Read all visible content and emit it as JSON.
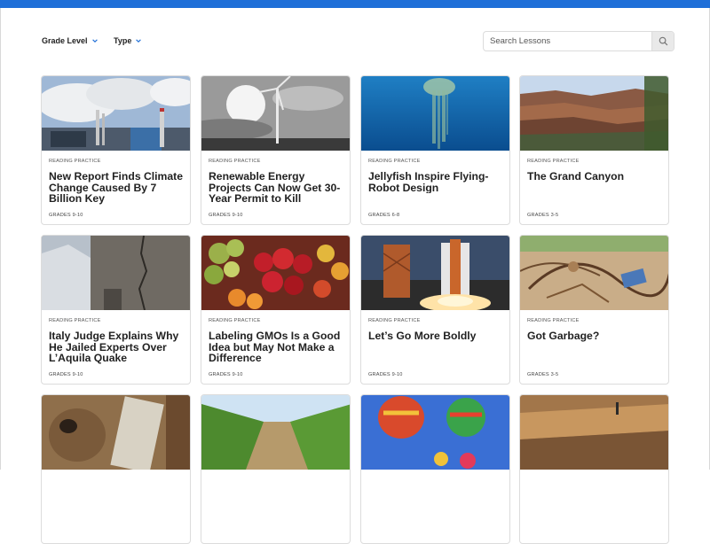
{
  "filters": {
    "grade_level": "Grade Level",
    "type": "Type"
  },
  "search": {
    "placeholder": "Search Lessons"
  },
  "icons": {
    "search": "search-icon",
    "chevron": "chevron-down-icon"
  },
  "colors": {
    "accent": "#1f6fd8"
  },
  "cards": [
    {
      "label": "READING PRACTICE",
      "title": "New Report Finds Climate Change Caused By 7 Billion Key",
      "grade": "GRADES 9-10",
      "image": "factory-smokestacks"
    },
    {
      "label": "READING PRACTICE",
      "title": "Renewable Energy Projects Can Now Get 30-Year Permit to Kill",
      "grade": "GRADES 9-10",
      "image": "wind-turbine"
    },
    {
      "label": "READING PRACTICE",
      "title": "Jellyfish Inspire Flying-Robot Design",
      "grade": "GRADES 6-8",
      "image": "jellyfish"
    },
    {
      "label": "READING PRACTICE",
      "title": "The Grand Canyon",
      "grade": "GRADES 3-5",
      "image": "grand-canyon"
    },
    {
      "label": "READING PRACTICE",
      "title": "Italy Judge Explains Why He Jailed Experts Over L’Aquila Quake",
      "grade": "GRADES 9-10",
      "image": "cracked-building"
    },
    {
      "label": "READING PRACTICE",
      "title": "Labeling GMOs Is a Good Idea but May Not Make a Difference",
      "grade": "GRADES 9-10",
      "image": "fruit-market"
    },
    {
      "label": "READING PRACTICE",
      "title": "Let’s Go More Boldly",
      "grade": "GRADES 9-10",
      "image": "space-shuttle"
    },
    {
      "label": "READING PRACTICE",
      "title": "Got Garbage?",
      "grade": "GRADES 3-5",
      "image": "garbage-pile"
    },
    {
      "label": "",
      "title": "",
      "grade": "",
      "image": "monkey-with-book"
    },
    {
      "label": "",
      "title": "",
      "grade": "",
      "image": "corn-field"
    },
    {
      "label": "",
      "title": "",
      "grade": "",
      "image": "hot-air-balloons"
    },
    {
      "label": "",
      "title": "",
      "grade": "",
      "image": "dirt-trench"
    }
  ]
}
